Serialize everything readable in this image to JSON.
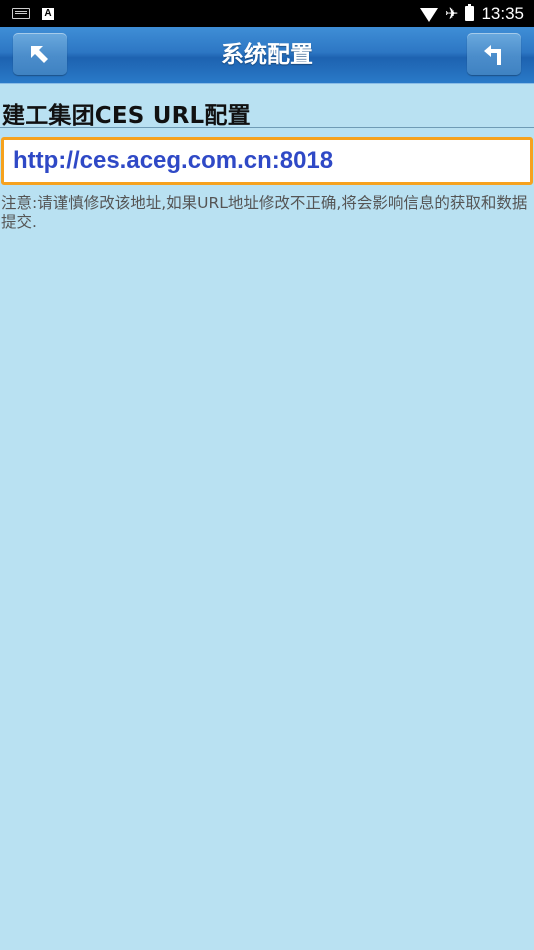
{
  "status_bar": {
    "time": "13:35",
    "left_icons": [
      "keyboard-icon",
      "text-a-icon"
    ],
    "right_icons": [
      "wifi-icon",
      "airplane-icon",
      "battery-icon"
    ]
  },
  "header": {
    "title": "系统配置",
    "left_button_icon": "back-arrow-icon",
    "right_button_icon": "return-icon"
  },
  "content": {
    "heading": "建工集团CES URL配置",
    "url_value": "http://ces.aceg.com.cn:8018",
    "note": "注意:请谨慎修改该地址,如果URL地址修改不正确,将会影响信息的获取和数据提交."
  },
  "colors": {
    "background": "#b9e1f2",
    "header": "#2d77c4",
    "input_border": "#f6a21e",
    "url_text": "#2f49c6"
  }
}
